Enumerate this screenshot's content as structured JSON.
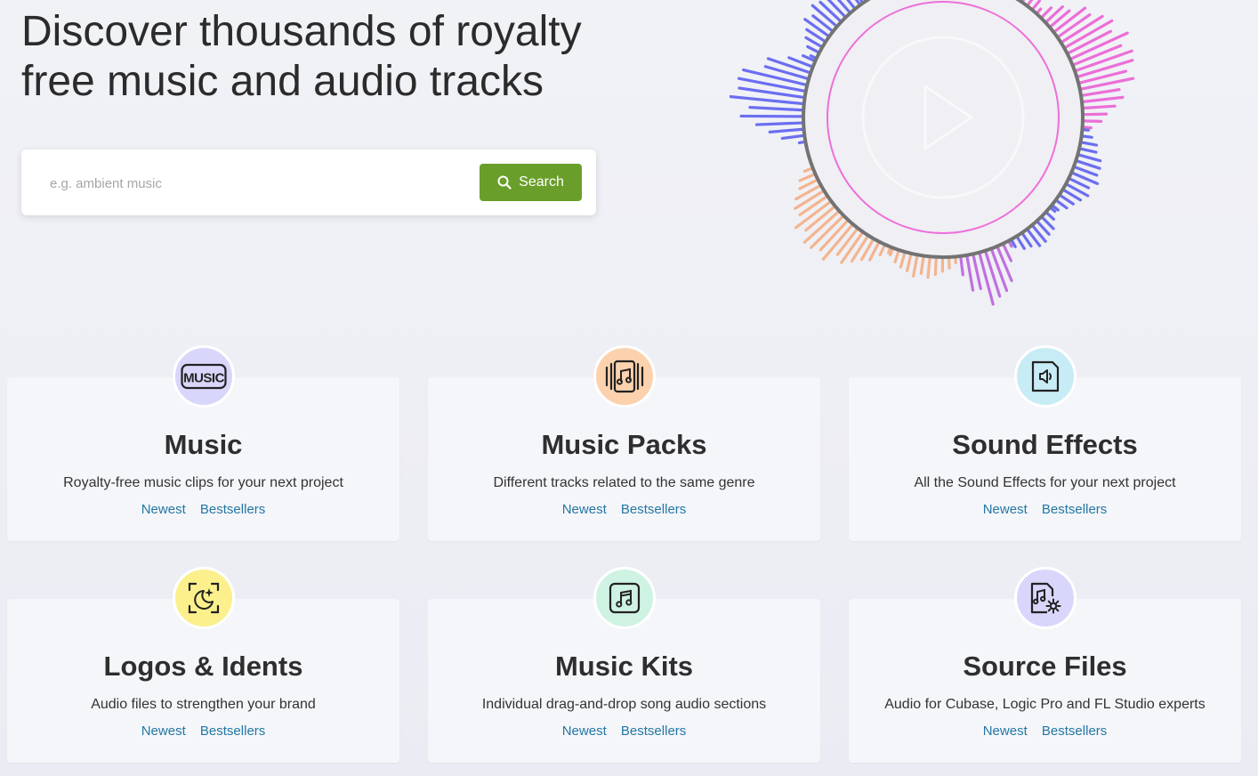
{
  "hero": {
    "title_line1": "Discover thousands of royalty",
    "title_line2": "free music and audio tracks"
  },
  "search": {
    "placeholder": "e.g. ambient music",
    "button_label": "Search",
    "button_color": "#6a9e2a"
  },
  "categories": [
    {
      "title": "Music",
      "description": "Royalty-free music clips for your next project",
      "newest": "Newest",
      "bestsellers": "Bestsellers",
      "icon": "music-text-icon",
      "icon_bg": "#d9d6fb"
    },
    {
      "title": "Music Packs",
      "description": "Different tracks related to the same genre",
      "newest": "Newest",
      "bestsellers": "Bestsellers",
      "icon": "music-pack-icon",
      "icon_bg": "#fbd2ad"
    },
    {
      "title": "Sound Effects",
      "description": "All the Sound Effects for your next project",
      "newest": "Newest",
      "bestsellers": "Bestsellers",
      "icon": "speaker-file-icon",
      "icon_bg": "#c8ecf5"
    },
    {
      "title": "Logos & Idents",
      "description": "Audio files to strengthen your brand",
      "newest": "Newest",
      "bestsellers": "Bestsellers",
      "icon": "sparkle-moon-icon",
      "icon_bg": "#fbf08c"
    },
    {
      "title": "Music Kits",
      "description": "Individual drag-and-drop song audio sections",
      "newest": "Newest",
      "bestsellers": "Bestsellers",
      "icon": "music-note-box-icon",
      "icon_bg": "#cff3e3"
    },
    {
      "title": "Source Files",
      "description": "Audio for Cubase, Logic Pro and FL Studio experts",
      "newest": "Newest",
      "bestsellers": "Bestsellers",
      "icon": "music-file-gear-icon",
      "icon_bg": "#d9d6fb"
    }
  ],
  "colors": {
    "link": "#2377a4",
    "wave_blue": "#6b6ef0",
    "wave_pink": "#ec6fd8",
    "wave_orange": "#f4b48f",
    "wave_purple": "#c070e0"
  }
}
